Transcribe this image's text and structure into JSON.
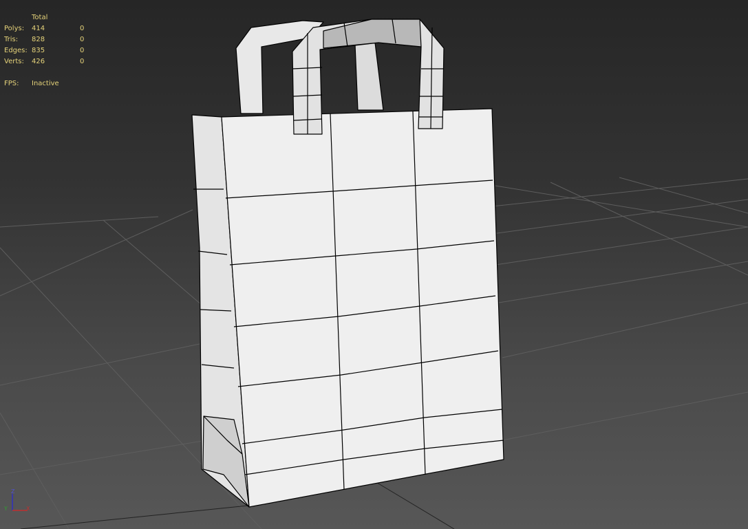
{
  "stats": {
    "header": "Total",
    "rows": [
      {
        "label": "Polys:",
        "total": "414",
        "selected": "0"
      },
      {
        "label": "Tris:",
        "total": "828",
        "selected": "0"
      },
      {
        "label": "Edges:",
        "total": "835",
        "selected": "0"
      },
      {
        "label": "Verts:",
        "total": "426",
        "selected": "0"
      }
    ],
    "fps_label": "FPS:",
    "fps_value": "Inactive"
  },
  "gizmo": {
    "x": "X",
    "y": "Y",
    "z": "Z",
    "x_color": "#c03030",
    "y_color": "#30a030",
    "z_color": "#3030c0"
  },
  "colors": {
    "stats_text": "#e6d37a",
    "mesh": "#f0f0f0",
    "wire": "#000000"
  }
}
